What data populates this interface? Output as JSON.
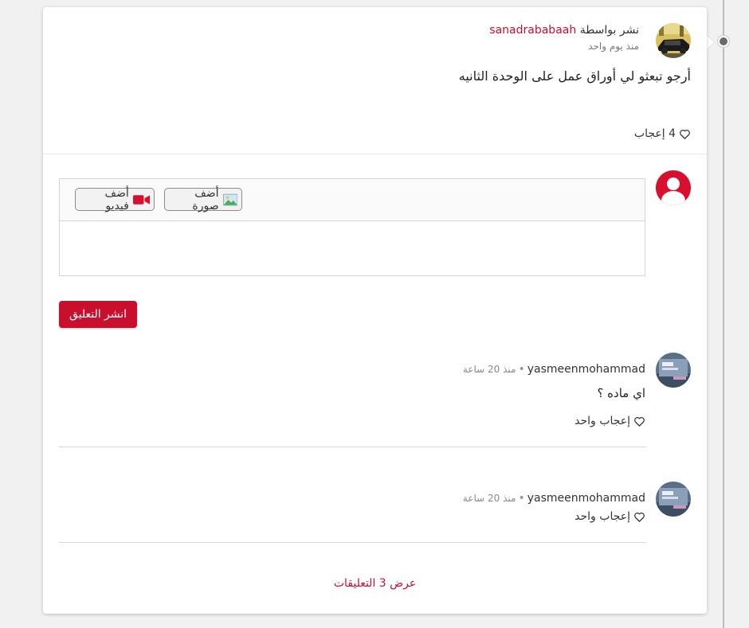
{
  "post": {
    "posted_by_prefix": "نشر بواسطة",
    "author": "sanadrababaah",
    "time": "منذ يوم واحد",
    "body": "أرجو تبعثو لي أوراق عمل على الوحدة الثانيه",
    "likes": "4 إعجاب"
  },
  "composer": {
    "add_image": "أضف صورة",
    "add_video": "أضف فيديو",
    "publish": "انشر التعليق"
  },
  "comments": [
    {
      "author": "yasmeenmohammad",
      "separator": "•",
      "time": "منذ 20 ساعة",
      "body": "اي ماده ؟",
      "likes": "إعجاب واحد"
    },
    {
      "author": "yasmeenmohammad",
      "separator": "•",
      "time": "منذ 20 ساعة",
      "body": "",
      "likes": "إعجاب واحد"
    }
  ],
  "view_more": "عرض 3 التعليقات",
  "colors": {
    "accent": "#c8102e",
    "text": "#333333",
    "muted": "#777777"
  },
  "icons": {
    "heart": "heart-icon",
    "image": "image-icon",
    "video": "video-camera-icon",
    "user": "user-avatar-icon"
  }
}
